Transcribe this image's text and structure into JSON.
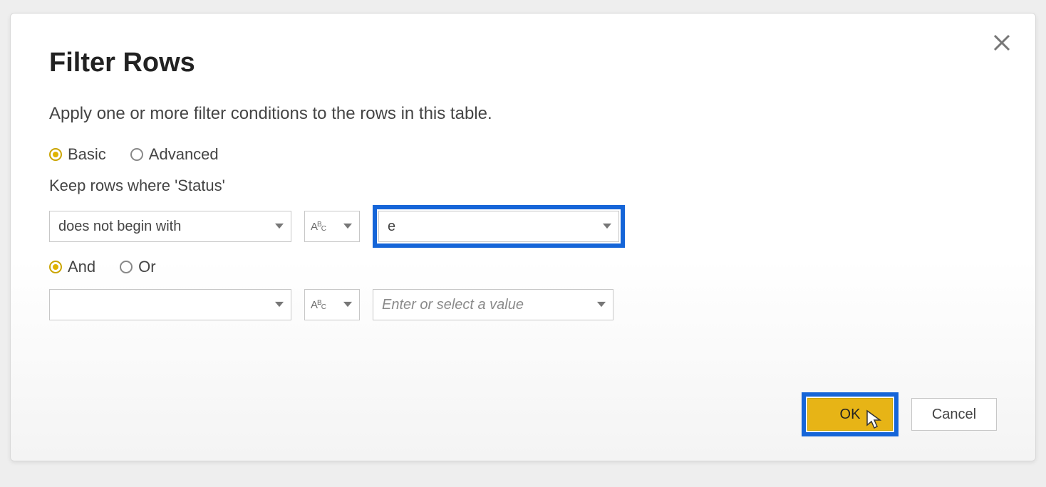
{
  "dialog": {
    "title": "Filter Rows",
    "subtitle": "Apply one or more filter conditions to the rows in this table.",
    "mode": {
      "basic_label": "Basic",
      "advanced_label": "Advanced"
    },
    "keep_rows_label": "Keep rows where 'Status'",
    "condition1": {
      "operator": "does not begin with",
      "value": "e"
    },
    "joiner": {
      "and_label": "And",
      "or_label": "Or"
    },
    "condition2": {
      "operator": "",
      "value_placeholder": "Enter or select a value"
    },
    "buttons": {
      "ok": "OK",
      "cancel": "Cancel"
    },
    "icons": {
      "text_type": "ABC"
    }
  }
}
